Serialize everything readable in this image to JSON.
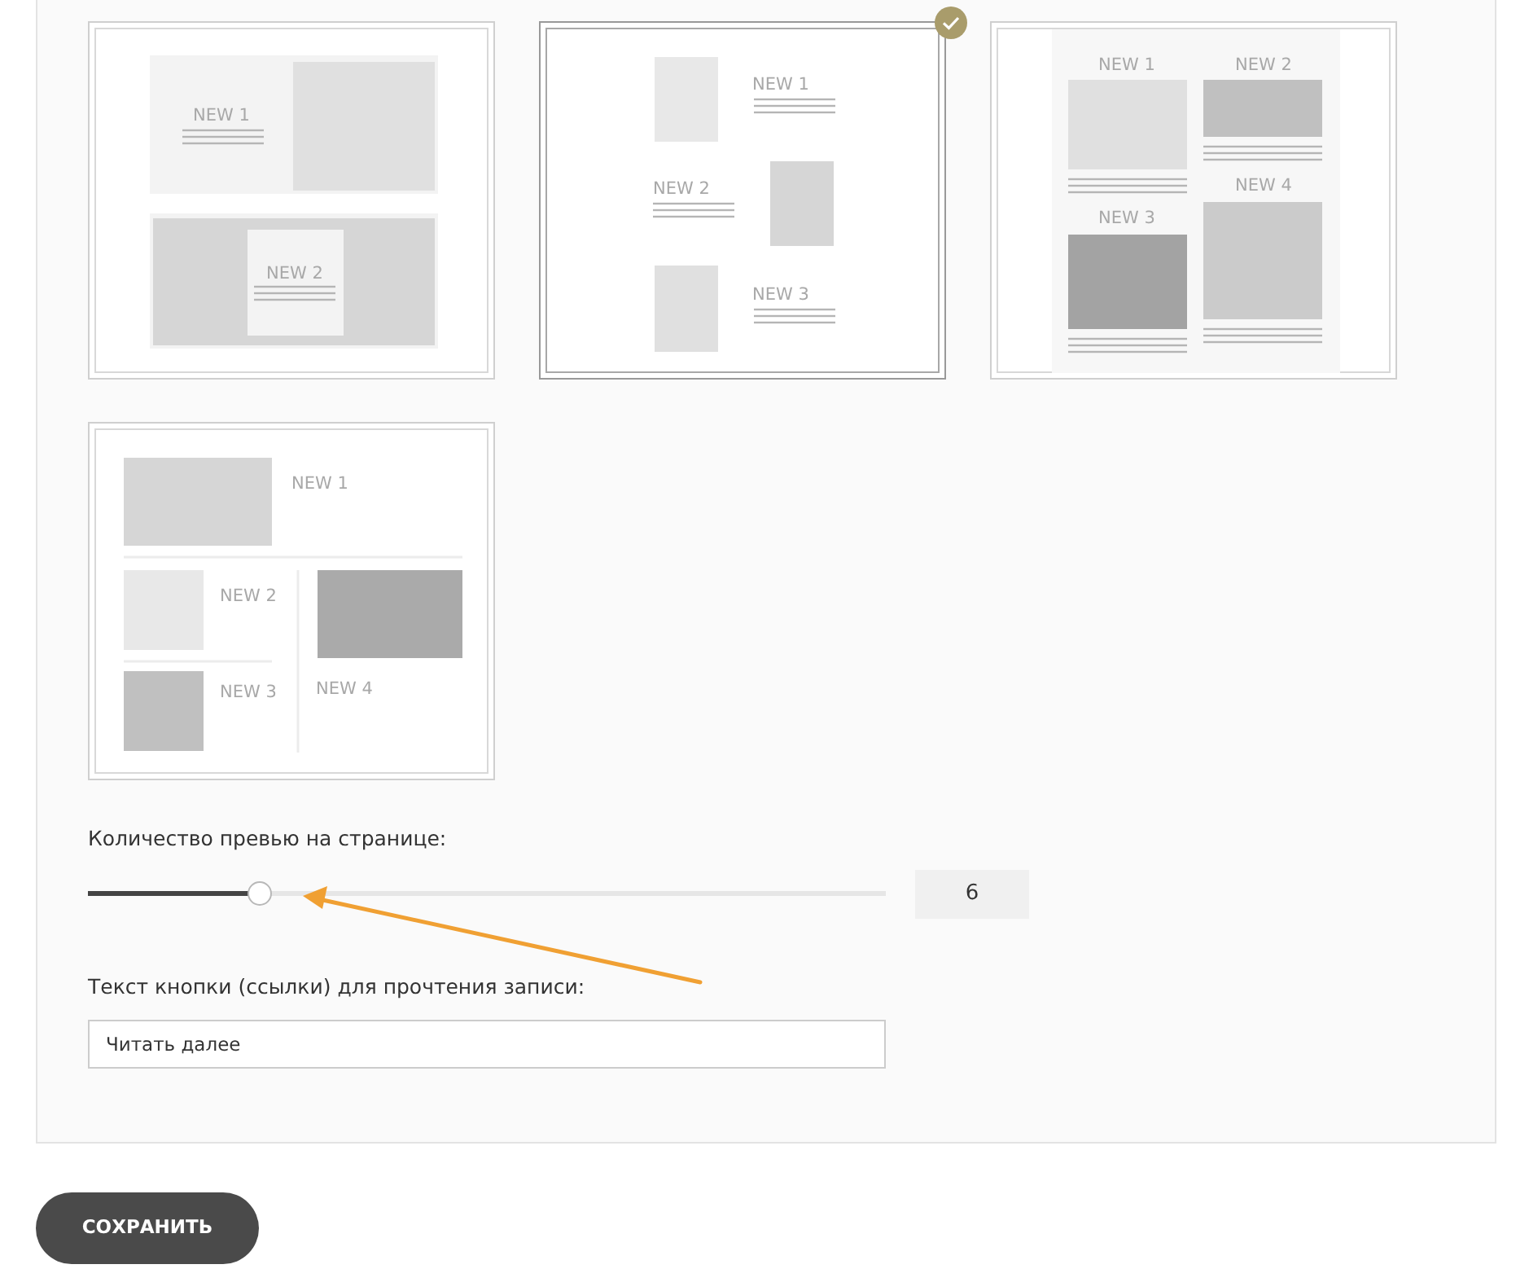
{
  "layouts": [
    {
      "kind": "split",
      "selected": false,
      "labels": [
        "NEW 1",
        "NEW 2"
      ]
    },
    {
      "kind": "zigzag",
      "selected": true,
      "labels": [
        "NEW 1",
        "NEW 2",
        "NEW 3"
      ]
    },
    {
      "kind": "masonry",
      "selected": false,
      "labels": [
        "NEW 1",
        "NEW 2",
        "NEW 4",
        "NEW 3"
      ]
    },
    {
      "kind": "list",
      "selected": false,
      "labels": [
        "NEW 1",
        "NEW 2",
        "NEW 3",
        "NEW 4"
      ]
    }
  ],
  "previews_per_page": {
    "label": "Количество превью на странице:",
    "level": 0.214,
    "value": "6"
  },
  "read_more": {
    "label": "Текст кнопки (ссылки) для прочтения записи:",
    "value": "Читать далее"
  },
  "save_button": "СОХРАНИТЬ"
}
